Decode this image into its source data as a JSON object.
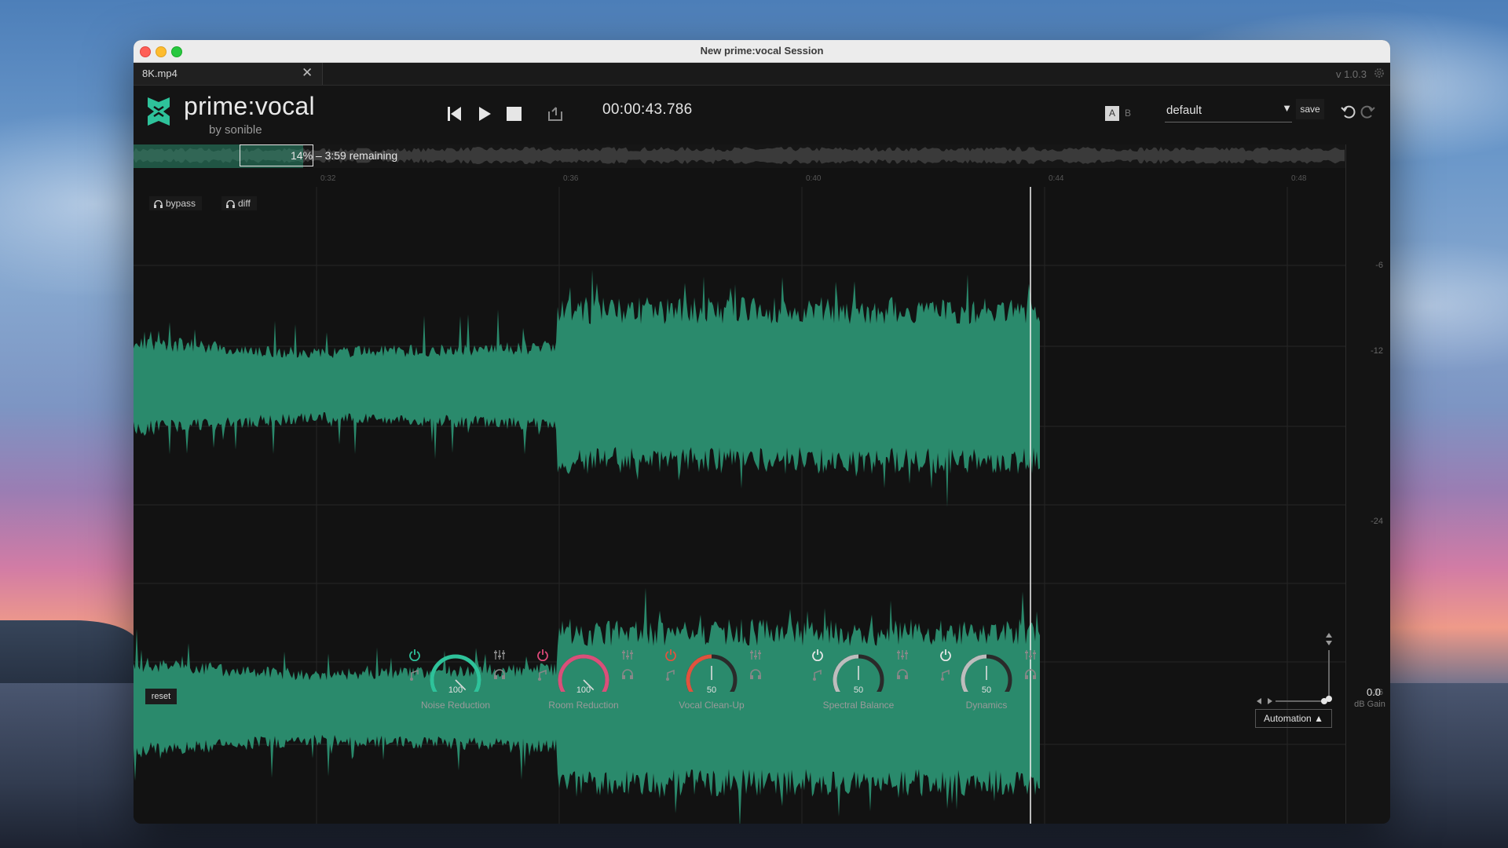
{
  "window": {
    "title": "New prime:vocal Session"
  },
  "tab": {
    "label": "8K.mp4",
    "close_icon": "close-icon"
  },
  "version": "v 1.0.3",
  "brand": {
    "name": "prime:vocal",
    "by": "by sonible",
    "logo": "prime-vocal-logo"
  },
  "transport": {
    "timecode": "00:00:43.786",
    "icons": [
      "skip-back-icon",
      "play-icon",
      "stop-icon",
      "loop-icon"
    ]
  },
  "preset": {
    "ab_a": "A",
    "ab_b": "B",
    "name": "default",
    "save_label": "save"
  },
  "overview": {
    "progress_text": "14% – 3:59 remaining",
    "progress_fraction": 0.14
  },
  "ruler": {
    "ticks": [
      "0:32",
      "0:36",
      "0:40",
      "0:44",
      "0:48"
    ]
  },
  "db_scale": [
    "-6",
    "-12",
    "-24",
    "-36"
  ],
  "toggles": {
    "bypass": "bypass",
    "diff": "diff"
  },
  "modules": [
    {
      "name": "Noise Reduction",
      "value": "100",
      "level": 1.0,
      "color": "#2ec29a",
      "power_color": "#2ec29a"
    },
    {
      "name": "Room Reduction",
      "value": "100",
      "level": 1.0,
      "color": "#d9507a",
      "power_color": "#e04a7a"
    },
    {
      "name": "Vocal Clean-Up",
      "value": "50",
      "level": 0.5,
      "color": "#e0533e",
      "power_color": "#e0533e"
    },
    {
      "name": "Spectral Balance",
      "value": "50",
      "level": 0.5,
      "color": "#bdbdbd",
      "power_color": "#e8e8e8"
    },
    {
      "name": "Dynamics",
      "value": "50",
      "level": 0.5,
      "color": "#bdbdbd",
      "power_color": "#e8e8e8"
    }
  ],
  "reset_label": "reset",
  "automation_label": "Automation ▲",
  "gain": {
    "value": "0.0",
    "label": "dB Gain"
  },
  "colors": {
    "waveform": "#2a8a6c",
    "background": "#121212",
    "accent": "#2ec29a"
  }
}
